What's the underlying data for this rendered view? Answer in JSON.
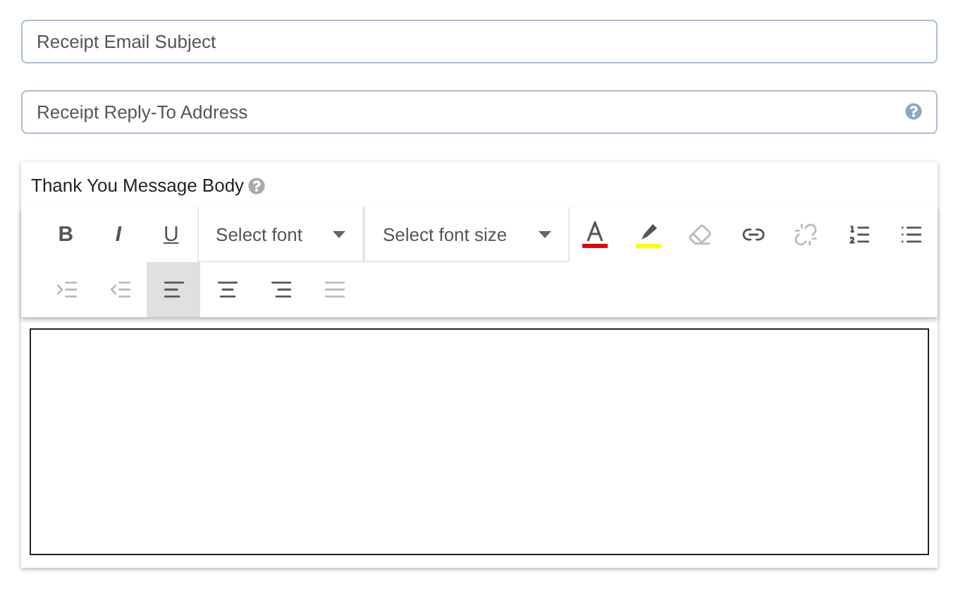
{
  "fields": [
    {
      "placeholder": "Receipt Email Subject",
      "help": false
    },
    {
      "placeholder": "Receipt Reply-To Address",
      "help": true
    }
  ],
  "editor": {
    "label": "Thank You Message Body",
    "toolbar_rows": [
      [
        {
          "kind": "bold",
          "label": "B",
          "disabled": false,
          "selected": false
        },
        {
          "kind": "italic",
          "label": "I",
          "disabled": false,
          "selected": false
        },
        {
          "kind": "underline",
          "label": "U",
          "disabled": false,
          "selected": false
        },
        {
          "kind": "select",
          "label": "Select font",
          "disabled": false,
          "selected": false
        },
        {
          "kind": "select",
          "label": "Select font size",
          "disabled": false,
          "selected": false
        },
        {
          "kind": "text-color",
          "color": "#e60000",
          "disabled": false,
          "selected": false
        },
        {
          "kind": "highlight",
          "color": "#ffff00",
          "disabled": false,
          "selected": false
        },
        {
          "kind": "clear-format",
          "disabled": true,
          "selected": false
        },
        {
          "kind": "link",
          "disabled": false,
          "selected": false
        },
        {
          "kind": "unlink",
          "disabled": true,
          "selected": false
        },
        {
          "kind": "ordered-list",
          "disabled": false,
          "selected": false
        },
        {
          "kind": "bullet-list",
          "disabled": false,
          "selected": false
        }
      ],
      [
        {
          "kind": "indent",
          "disabled": true,
          "selected": false
        },
        {
          "kind": "outdent",
          "disabled": true,
          "selected": false
        },
        {
          "kind": "align-left",
          "disabled": false,
          "selected": true
        },
        {
          "kind": "align-center",
          "disabled": false,
          "selected": false
        },
        {
          "kind": "align-right",
          "disabled": false,
          "selected": false
        },
        {
          "kind": "justify",
          "disabled": true,
          "selected": false
        }
      ]
    ]
  }
}
